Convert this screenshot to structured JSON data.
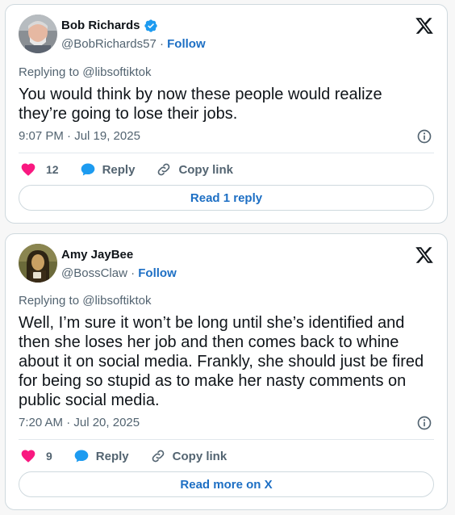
{
  "tweets": [
    {
      "author_name": "Bob Richards",
      "verified": true,
      "handle": "@BobRichards57",
      "separator": "·",
      "follow_label": "Follow",
      "replying_to": "Replying to @libsoftiktok",
      "text": "You would think by now these people would realize they’re going to lose their jobs.",
      "timestamp": "9:07 PM · Jul 19, 2025",
      "like_count": "12",
      "reply_label": "Reply",
      "copy_label": "Copy link",
      "cta_label": "Read 1 reply"
    },
    {
      "author_name": "Amy JayBee",
      "verified": false,
      "handle": "@BossClaw",
      "separator": "·",
      "follow_label": "Follow",
      "replying_to": "Replying to @libsoftiktok",
      "text": "Well, I’m sure it won’t be long until she’s identified and then she loses her job and then comes back to whine about it on social media. Frankly, she should just be fired for being so stupid as to make her nasty comments on public social media.",
      "timestamp": "7:20 AM · Jul 20, 2025",
      "like_count": "9",
      "reply_label": "Reply",
      "copy_label": "Copy link",
      "cta_label": "Read more on X"
    }
  ],
  "icons": {
    "logo": "x-logo-icon",
    "verified": "verified-badge-icon",
    "info": "info-icon",
    "like": "heart-icon",
    "reply": "speech-bubble-icon",
    "copy": "link-icon"
  },
  "colors": {
    "link_blue": "#1d6fc4",
    "heart": "#f91880",
    "reply_bubble": "#1d9bf0",
    "verified": "#1d9bf0",
    "muted_text": "#536471"
  }
}
